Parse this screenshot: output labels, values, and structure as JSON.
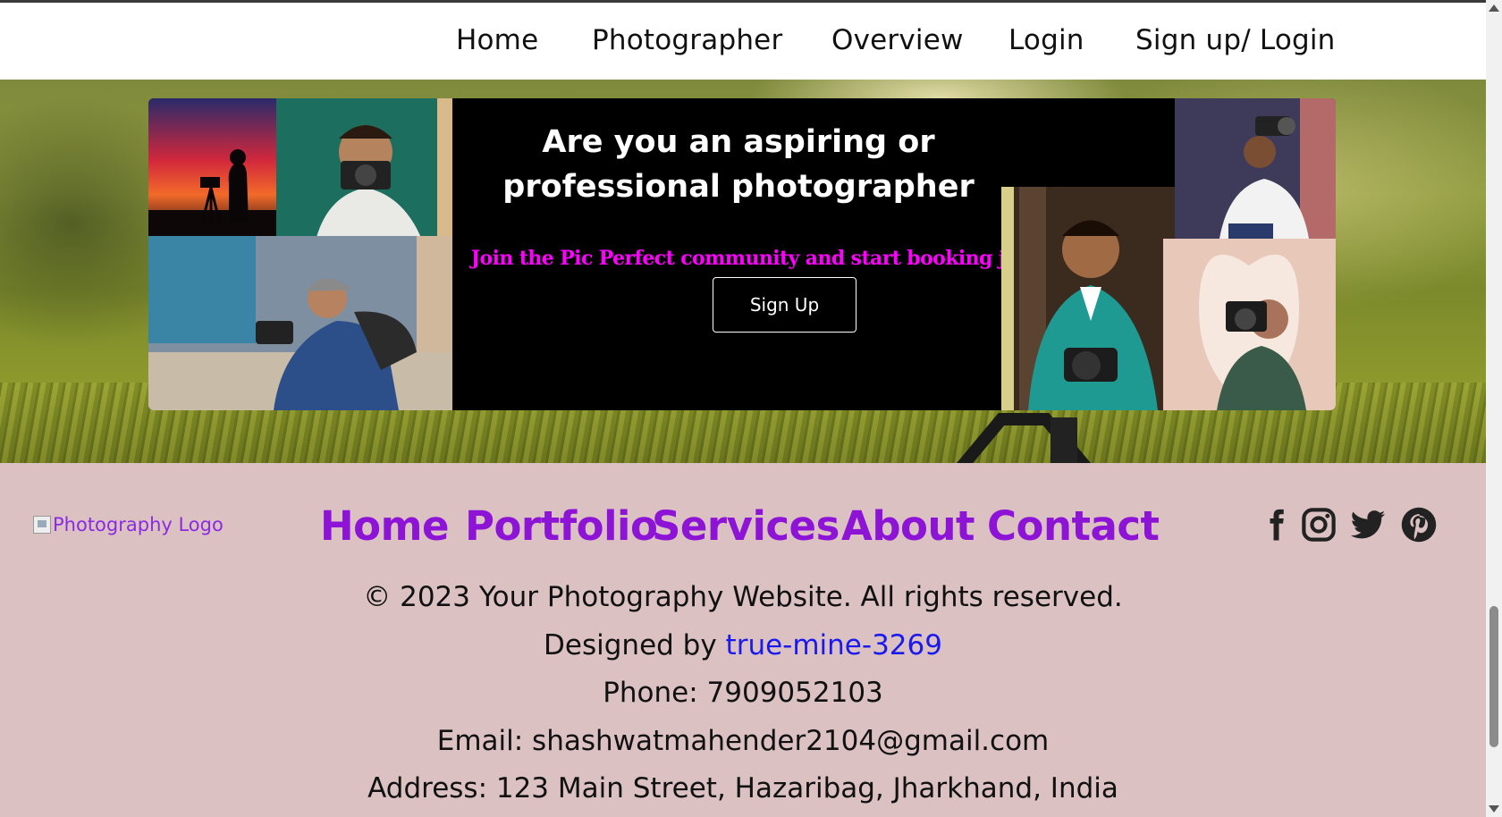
{
  "topnav": {
    "items": [
      "Home",
      "Photographer",
      "Overview",
      "Login",
      "Sign up/ Login"
    ]
  },
  "hero": {
    "headline_line1": "Are you an aspiring or",
    "headline_line2": "professional photographer",
    "tagline": "Join the Pic Perfect community and start booking jobs today!",
    "signup_label": "Sign Up",
    "photos": [
      "sunset-silhouette-photo",
      "photographer-white-tee-photo",
      "photographer-crouching-photo",
      "photographer-overhead-camera-photo",
      "photographer-teal-suit-photo",
      "photographer-heart-frame-photo"
    ]
  },
  "footer": {
    "logo_alt": "Photography Logo",
    "nav": [
      "Home",
      "Portfolio",
      "Services",
      "About",
      "Contact"
    ],
    "social_icons": [
      "facebook-icon",
      "instagram-icon",
      "twitter-icon",
      "pinterest-icon"
    ],
    "copyright": "© 2023 Your Photography Website. All rights reserved.",
    "designed_by_prefix": "Designed by ",
    "designer": "true-mine-3269",
    "phone": "Phone: 7909052103",
    "email": "Email: shashwatmahender2104@gmail.com",
    "address": "Address: 123 Main Street, Hazaribag, Jharkhand, India"
  },
  "colors": {
    "accent": "#8d14d6",
    "tagline": "#ff00ff",
    "link": "#1a1aee",
    "footer_bg": "#dcc1c3"
  }
}
